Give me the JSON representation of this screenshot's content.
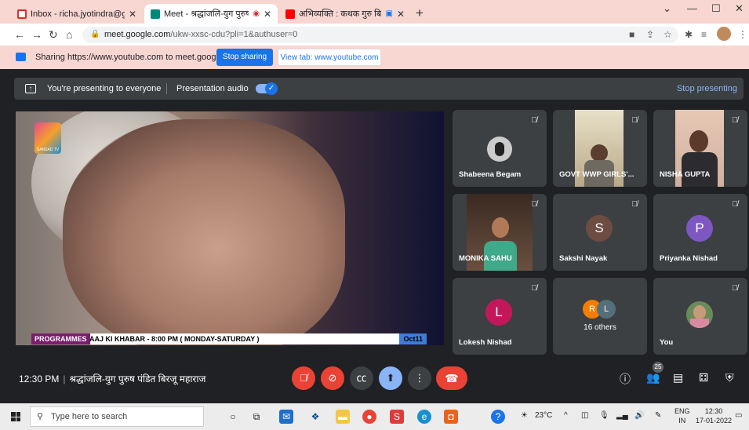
{
  "browser": {
    "tabs": [
      {
        "title": "Inbox - richa.jyotindra@gmail.co",
        "icon": "gmail-icon",
        "color": "#d93025"
      },
      {
        "title": "Meet - श्रद्धांजलि-युग पुरुष पंडित",
        "icon": "meet-icon",
        "color": "#00897b"
      },
      {
        "title": "अभिव्यक्ति : कथक गुरु बिरजू मह",
        "icon": "youtube-icon",
        "color": "#ff0000"
      }
    ],
    "url_host": "meet.google.com",
    "url_path": "/ukw-xxsc-cdu?pli=1&authuser=0"
  },
  "sharing_bar": {
    "text": "Sharing https://www.youtube.com to meet.google.com",
    "stop_label": "Stop sharing",
    "view_label": "View tab: www.youtube.com"
  },
  "presenting": {
    "status": "You're presenting to everyone",
    "audio_label": "Presentation audio",
    "audio_on": true,
    "stop_label": "Stop presenting"
  },
  "video": {
    "logo_text": "SANSAD TV",
    "ticker_tag": "PROGRAMMES",
    "ticker_text": "AAJ KI KHABAR - 8:00 PM ( MONDAY-SATURDAY )",
    "ticker_date": "Oct11"
  },
  "participants": [
    {
      "name": "Shabeena Begam",
      "type": "video"
    },
    {
      "name": "GOVT WWP GIRLS'...",
      "type": "video"
    },
    {
      "name": "NISHA GUPTA",
      "type": "video"
    },
    {
      "name": "MONIKA SAHU",
      "type": "video"
    },
    {
      "name": "Sakshi Nayak",
      "type": "avatar",
      "initial": "S",
      "color": "#6d4c41"
    },
    {
      "name": "Priyanka Nishad",
      "type": "avatar",
      "initial": "P",
      "color": "#7e57c2"
    },
    {
      "name": "Lokesh Nishad",
      "type": "avatar",
      "initial": "L",
      "color": "#c2185b"
    },
    {
      "name": "16 others",
      "type": "group",
      "initials": [
        "R",
        "L"
      ]
    },
    {
      "name": "You",
      "type": "self"
    }
  ],
  "meeting": {
    "time": "12:30 PM",
    "title": "श्रद्धांजलि-युग पुरुष पंडित बिरजू महाराज",
    "participant_count": "25"
  },
  "taskbar": {
    "search_placeholder": "Type here to search",
    "weather": "23°C",
    "lang_top": "ENG",
    "lang_bottom": "IN",
    "time": "12:30",
    "date": "17-01-2022"
  }
}
